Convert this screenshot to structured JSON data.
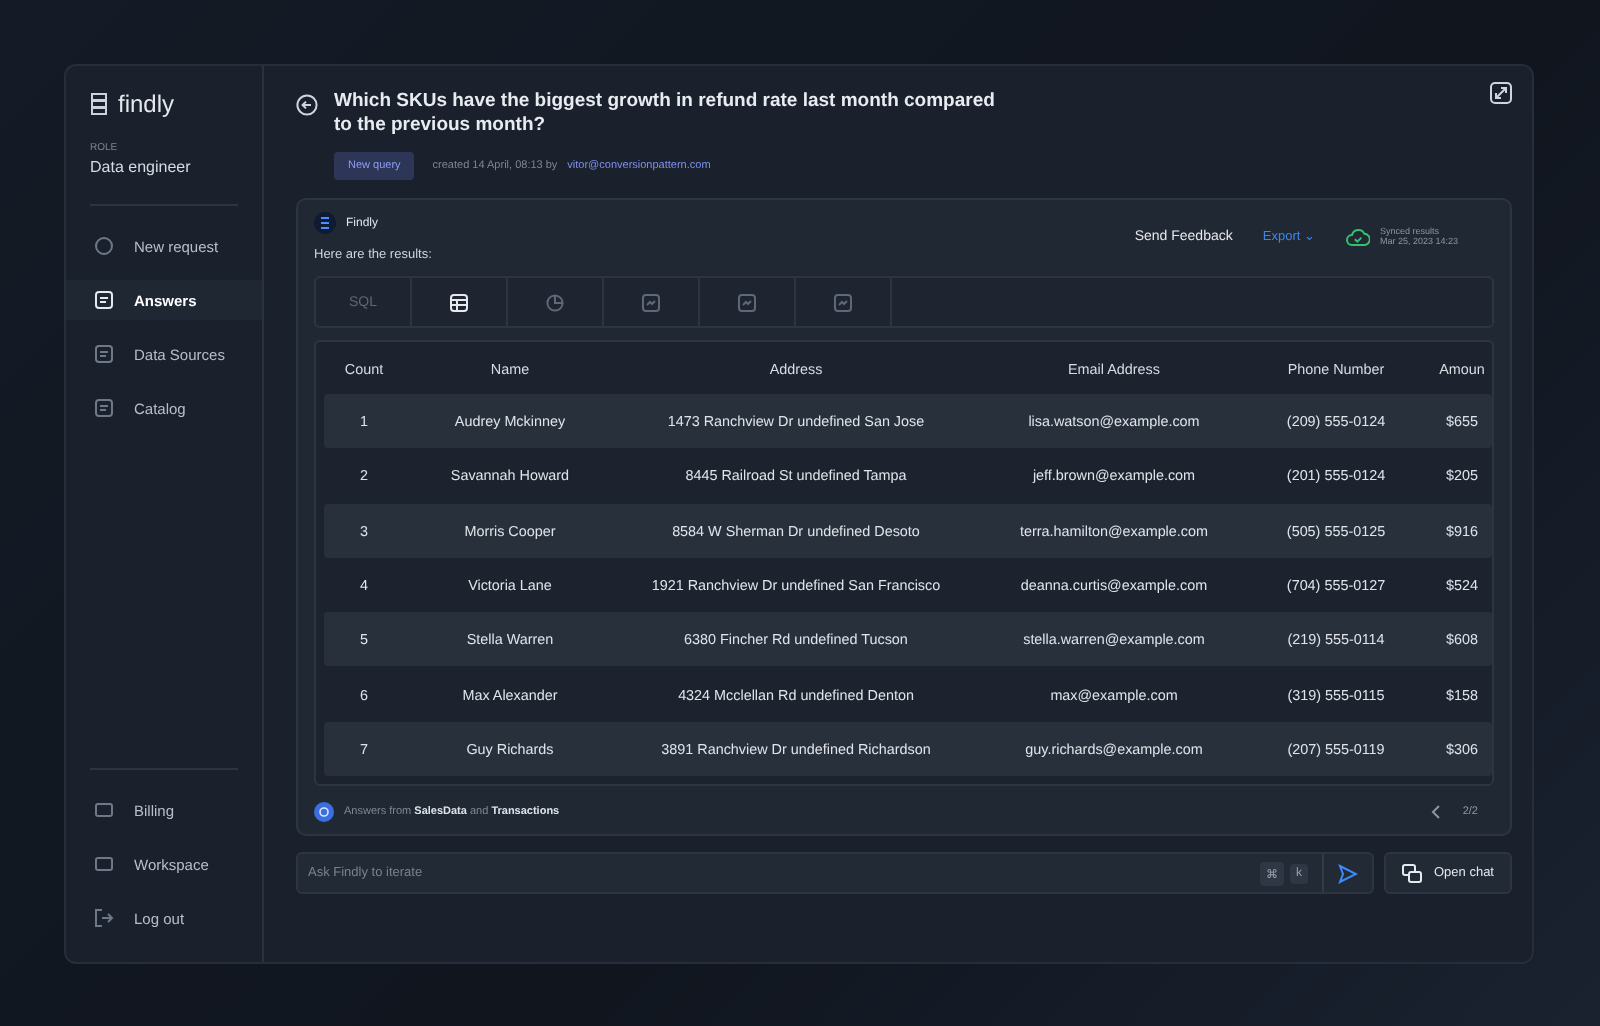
{
  "sidebar": {
    "logo": "findly",
    "role_label": "ROLE",
    "role": "Data engineer",
    "items": [
      {
        "label": "New request",
        "selected": false
      },
      {
        "label": "Answers",
        "selected": true
      },
      {
        "label": "Data Sources",
        "selected": false
      },
      {
        "label": "Catalog",
        "selected": false
      }
    ],
    "bottom_items": [
      {
        "label": "Billing"
      },
      {
        "label": "Workspace"
      },
      {
        "label": "Log out"
      }
    ]
  },
  "header": {
    "title": "Which SKUs have the biggest growth in refund rate last month compared to the previous month?",
    "badge": "New query",
    "meta": "created 14 April, 08:13 by",
    "author": "vitor@conversionpattern.com"
  },
  "answer": {
    "bot_name": "Findly",
    "intro": "Here are the results:",
    "feedback": "Send Feedback",
    "export": "Export ⌄",
    "synced_label": "Synced results",
    "synced_time": "Mar 25, 2023 14:23",
    "tabs": [
      {
        "kind": "text",
        "label": "SQL",
        "selected": false
      },
      {
        "kind": "icon",
        "selected": true
      },
      {
        "kind": "icon",
        "selected": false
      },
      {
        "kind": "icon",
        "selected": false
      },
      {
        "kind": "icon",
        "selected": false
      },
      {
        "kind": "icon",
        "selected": false
      }
    ],
    "table": {
      "columns": [
        "Count",
        "Name",
        "Address",
        "Email Address",
        "Phone Number",
        "Amoun"
      ],
      "rows": [
        [
          "1",
          "Audrey Mckinney",
          "1473 Ranchview Dr undefined San Jose",
          "lisa.watson@example.com",
          "(209) 555-0124",
          "$655"
        ],
        [
          "2",
          "Savannah Howard",
          "8445 Railroad St undefined Tampa",
          "jeff.brown@example.com",
          "(201) 555-0124",
          "$205"
        ],
        [
          "3",
          "Morris Cooper",
          "8584 W Sherman Dr undefined Desoto",
          "terra.hamilton@example.com",
          "(505) 555-0125",
          "$916"
        ],
        [
          "4",
          "Victoria Lane",
          "1921 Ranchview Dr undefined San Francisco",
          "deanna.curtis@example.com",
          "(704) 555-0127",
          "$524"
        ],
        [
          "5",
          "Stella Warren",
          "6380 Fincher Rd undefined Tucson",
          "stella.warren@example.com",
          "(219) 555-0114",
          "$608"
        ],
        [
          "6",
          "Max Alexander",
          "4324 Mcclellan Rd undefined Denton",
          "max@example.com",
          "(319) 555-0115",
          "$158"
        ],
        [
          "7",
          "Guy Richards",
          "3891 Ranchview Dr undefined Richardson",
          "guy.richards@example.com",
          "(207) 555-0119",
          "$306"
        ]
      ]
    },
    "sources": "Answers from **SalesData** and **Transactions**",
    "pager": "2/2"
  },
  "composer": {
    "placeholder": "Ask Findly to iterate",
    "shortcut": [
      "⌘",
      "k"
    ],
    "open_chat": "Open chat"
  }
}
